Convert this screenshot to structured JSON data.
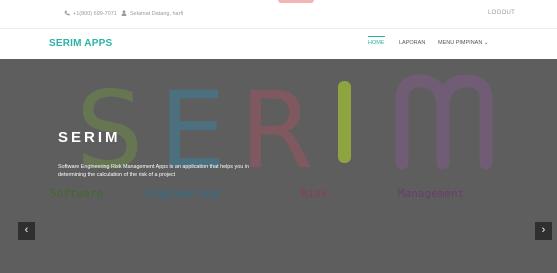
{
  "topbar": {
    "phone_icon": "phone-icon",
    "phone": "+1(800) 699-7071",
    "user_icon": "user-icon",
    "greeting": "Selamat Datang, harfi",
    "logout": "LOGOUT"
  },
  "navbar": {
    "brand": "SERIM APPS",
    "home": "HOME",
    "laporan": "LAPORAN",
    "menu_pimpinan": "MENU PIMPINAN ⌄"
  },
  "hero": {
    "logo_letters": [
      "S",
      "E",
      "R",
      "I",
      "M"
    ],
    "title": "SERIM",
    "description": "Software Engineering Risk Management Apps is an application that helps you in determining the calculation of the risk of a project",
    "words": [
      "Software",
      "Engineering",
      "Risk",
      "Management"
    ],
    "prev": "‹",
    "next": "›",
    "colors": {
      "overlay": "#5e5e5e",
      "s": "#6f8a4a",
      "e": "#3f7f9a",
      "r": "#9a5560",
      "i": "#9ab53a",
      "m": "#7d5b84"
    }
  },
  "colors": {
    "brand": "#2ab3a6",
    "accent": "#f3b5b5"
  }
}
